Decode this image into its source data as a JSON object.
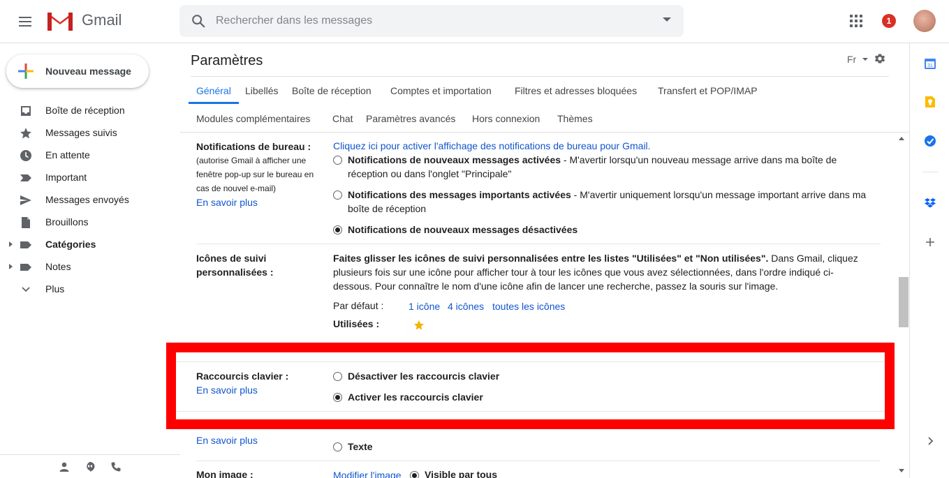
{
  "header": {
    "app_name": "Gmail",
    "search_placeholder": "Rechercher dans les messages",
    "notification_count": "1"
  },
  "sidebar": {
    "compose_label": "Nouveau message",
    "items": [
      {
        "label": "Boîte de réception",
        "icon": "inbox-icon"
      },
      {
        "label": "Messages suivis",
        "icon": "star-icon"
      },
      {
        "label": "En attente",
        "icon": "clock-icon"
      },
      {
        "label": "Important",
        "icon": "important-icon"
      },
      {
        "label": "Messages envoyés",
        "icon": "send-icon"
      },
      {
        "label": "Brouillons",
        "icon": "draft-icon"
      },
      {
        "label": "Catégories",
        "icon": "label-icon"
      },
      {
        "label": "Notes",
        "icon": "label-icon"
      },
      {
        "label": "Plus",
        "icon": "chevron-down-icon"
      }
    ]
  },
  "settings": {
    "title": "Paramètres",
    "language": "Fr",
    "tabs_row1": [
      "Général",
      "Libellés",
      "Boîte de réception",
      "Comptes et importation",
      "Filtres et adresses bloquées",
      "Transfert et POP/IMAP"
    ],
    "tabs_row2": [
      "Modules complémentaires",
      "Chat",
      "Paramètres avancés",
      "Hors connexion",
      "Thèmes"
    ],
    "desktop_notifications": {
      "label": "Notifications de bureau :",
      "sub": "(autorise Gmail à afficher une fenêtre pop-up sur le bureau en cas de nouvel e-mail)",
      "learn_more": "En savoir plus",
      "enable_link": "Cliquez ici pour activer l'affichage des notifications de bureau pour Gmail.",
      "opt1_bold": "Notifications de nouveaux messages activées",
      "opt1_rest": " - M'avertir lorsqu'un nouveau message arrive dans ma boîte de réception ou dans l'onglet \"Principale\"",
      "opt2_bold": "Notifications des messages importants activées",
      "opt2_rest": " - M'avertir uniquement lorsqu'un message important arrive dans ma boîte de réception",
      "opt3_bold": "Notifications de nouveaux messages désactivées"
    },
    "stars": {
      "label": "Icônes de suivi personnalisées :",
      "desc_bold": "Faites glisser les icônes de suivi personnalisées entre les listes \"Utilisées\" et \"Non utilisées\".",
      "desc_rest": " Dans Gmail, cliquez plusieurs fois sur une icône pour afficher tour à tour les icônes que vous avez sélectionnées, dans l'ordre indiqué ci-dessous. Pour connaître le nom d'une icône afin de lancer une recherche, passez la souris sur l'image.",
      "presets_label": "Par défaut :",
      "preset1": "1 icône",
      "preset2": "4 icônes",
      "preset3": "toutes les icônes",
      "used_label": "Utilisées :"
    },
    "shortcuts": {
      "label": "Raccourcis clavier :",
      "learn_more": "En savoir plus",
      "opt_off": "Désactiver les raccourcis clavier",
      "opt_on": "Activer les raccourcis clavier"
    },
    "button_labels": {
      "learn_more": "En savoir plus",
      "opt_text": "Texte"
    },
    "my_picture": {
      "label": "Mon image :",
      "link": "Modifier l'image",
      "visible": "Visible par tous"
    }
  },
  "colors": {
    "accent": "#1a73e8",
    "link": "#1155cc",
    "highlight": "#ff0000",
    "badge": "#d93025"
  }
}
